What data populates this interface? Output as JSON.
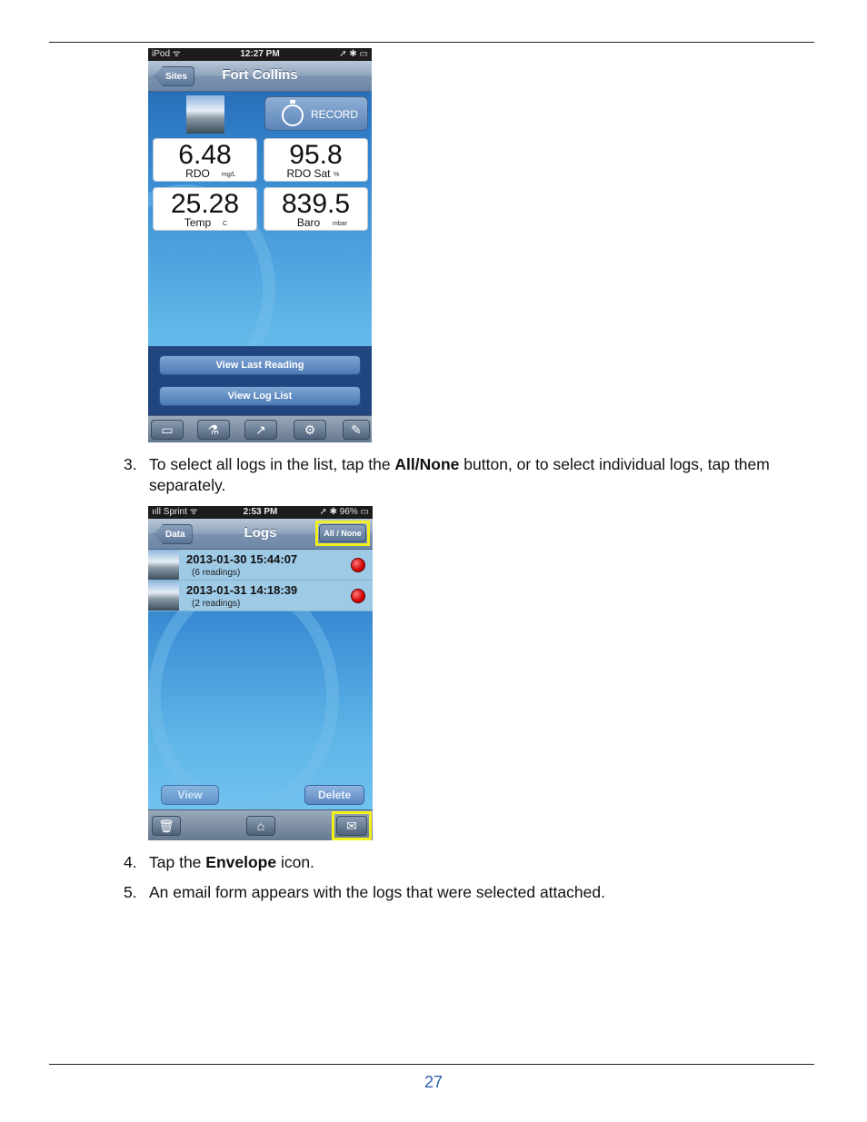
{
  "page_number": "27",
  "screen1": {
    "status": {
      "left": "iPod ᯤ",
      "time": "12:27 PM",
      "right": "➚ ✱ ▭"
    },
    "nav_title": "Fort Collins",
    "back_label": "Sites",
    "record_label": "RECORD",
    "tiles": [
      {
        "value": "6.48",
        "name": "RDO",
        "unit": "mg/L"
      },
      {
        "value": "95.8",
        "name": "RDO Sat",
        "unit": "%"
      },
      {
        "value": "25.28",
        "name": "Temp",
        "unit": "C"
      },
      {
        "value": "839.5",
        "name": "Baro",
        "unit": "mbar"
      }
    ],
    "buttons": {
      "last_reading": "View Last Reading",
      "log_list": "View Log List"
    },
    "tab_icons": [
      "archive-icon",
      "flask-icon",
      "share-icon",
      "gear-icon",
      "pen-icon"
    ]
  },
  "steps": {
    "s3": {
      "num": "3.",
      "before": "To select all logs in the list, tap the ",
      "bold": "All/None",
      "after": " button, or to select individual logs, tap them separately."
    },
    "s4": {
      "num": "4.",
      "before": "Tap the ",
      "bold": "Envelope",
      "after": " icon."
    },
    "s5": {
      "num": "5.",
      "text": "An email form appears with the logs that were selected attached."
    }
  },
  "screen2": {
    "status": {
      "left": "ııll Sprint ᯤ",
      "time": "2:53 PM",
      "right": "➚ ✱ 96% ▭"
    },
    "nav_title": "Logs",
    "back_label": "Data",
    "all_none": "All / None",
    "logs": [
      {
        "date": "2013-01-30 15:44:07",
        "count": "(6 readings)"
      },
      {
        "date": "2013-01-31 14:18:39",
        "count": "(2 readings)"
      }
    ],
    "view_label": "View",
    "delete_label": "Delete",
    "tab_icons": [
      "trash-icon",
      "home-icon",
      "envelope-icon"
    ],
    "highlight_color": "#f2ef1e"
  }
}
